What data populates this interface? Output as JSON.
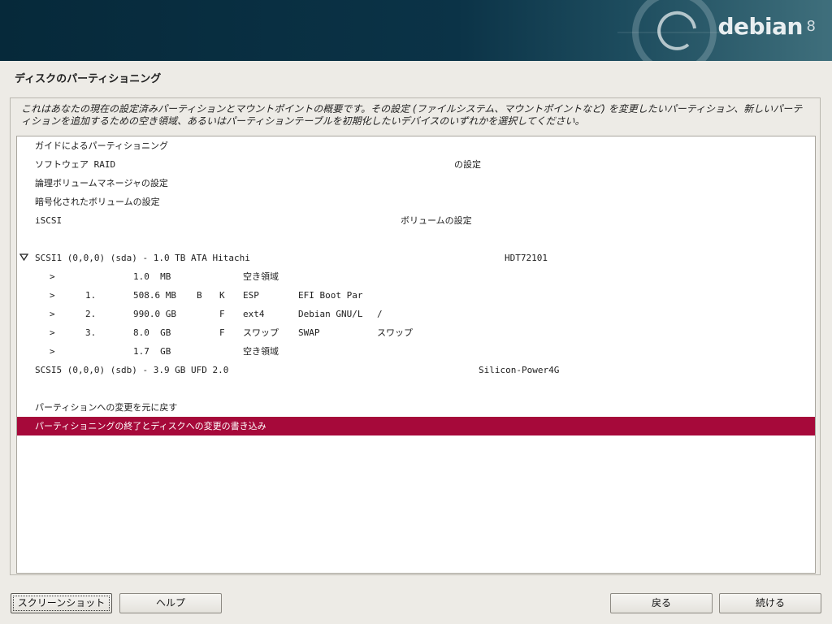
{
  "banner": {
    "brand": "debian",
    "version": "8"
  },
  "page_title": "ディスクのパーティショニング",
  "description": "これはあなたの現在の設定済みパーティションとマウントポイントの概要です。その設定 (ファイルシステム、マウントポイントなど) を変更したいパーティション、新しいパーティションを追加するための空き領域、あるいはパーティションテーブルを初期化したいデバイスのいずれかを選択してください。",
  "menu": {
    "guided": "ガイドによるパーティショニング",
    "raid_a": "ソフトウェア RAID",
    "raid_b": "の設定",
    "lvm": "論理ボリュームマネージャの設定",
    "crypto": "暗号化されたボリュームの設定",
    "iscsi_a": "iSCSI",
    "iscsi_b": "ボリュームの設定",
    "undo": "パーティションへの変更を元に戻す",
    "finish": "パーティショニングの終了とディスクへの変更の書き込み"
  },
  "disks": [
    {
      "label": "SCSI1 (0,0,0) (sda) - 1.0 TB ATA Hitachi",
      "model": "HDT72101",
      "partitions": [
        {
          "arrow": ">",
          "num": "",
          "size": "1.0  MB",
          "flag1": "",
          "flag2": "",
          "fs": "空き領域",
          "name": "",
          "mount": ""
        },
        {
          "arrow": ">",
          "num": "1.",
          "size": "508.6 MB",
          "flag1": "B",
          "flag2": "K",
          "fs": "ESP",
          "name": "EFI Boot Par",
          "mount": ""
        },
        {
          "arrow": ">",
          "num": "2.",
          "size": "990.0 GB",
          "flag1": "",
          "flag2": "F",
          "fs": "ext4",
          "name": "Debian GNU/L",
          "mount": "/"
        },
        {
          "arrow": ">",
          "num": "3.",
          "size": "8.0  GB",
          "flag1": "",
          "flag2": "F",
          "fs": "スワップ",
          "name": "SWAP",
          "mount": "スワップ"
        },
        {
          "arrow": ">",
          "num": "",
          "size": "1.7  GB",
          "flag1": "",
          "flag2": "",
          "fs": "空き領域",
          "name": "",
          "mount": ""
        }
      ]
    },
    {
      "label": "SCSI5 (0,0,0) (sdb) - 3.9 GB UFD 2.0",
      "model": "Silicon-Power4G"
    }
  ],
  "buttons": {
    "screenshot": "スクリーンショット",
    "help": "ヘルプ",
    "back": "戻る",
    "continue": "続ける"
  },
  "colors": {
    "selection": "#a6093a",
    "banner": "#0b3347"
  }
}
